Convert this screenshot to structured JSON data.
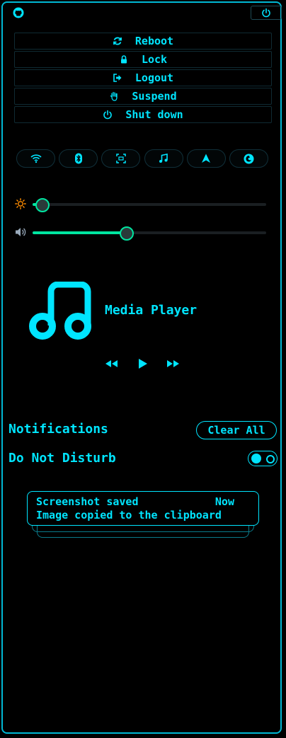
{
  "colors": {
    "accent": "#00e5ff",
    "slider_fill": "#00e5a0",
    "background": "#000000",
    "sun": "#ff8c00"
  },
  "top_bar": {
    "left_icon": "github-icon",
    "right_icon": "power-icon"
  },
  "power_menu": [
    {
      "label": "Reboot",
      "icon": "refresh-icon"
    },
    {
      "label": "Lock",
      "icon": "lock-icon"
    },
    {
      "label": "Logout",
      "icon": "logout-icon"
    },
    {
      "label": "Suspend",
      "icon": "hand-icon"
    },
    {
      "label": "Shut down",
      "icon": "power-icon"
    }
  ],
  "quick_settings": [
    "wifi-icon",
    "bluetooth-icon",
    "screenshot-icon",
    "music-note-icon",
    "navigation-icon",
    "firefox-icon"
  ],
  "sliders": {
    "brightness": {
      "icon": "sun-icon",
      "level": 0.04
    },
    "volume": {
      "icon": "speaker-icon",
      "level": 0.4
    }
  },
  "media": {
    "title": "Media Player",
    "icon": "music-note-icon"
  },
  "notifications": {
    "label": "Notifications",
    "clear_label": "Clear All",
    "dnd_label": "Do Not Disturb",
    "dnd_enabled": true,
    "items": [
      {
        "title": "Screenshot saved",
        "time": "Now",
        "body": "Image copied to the clipboard"
      }
    ]
  }
}
